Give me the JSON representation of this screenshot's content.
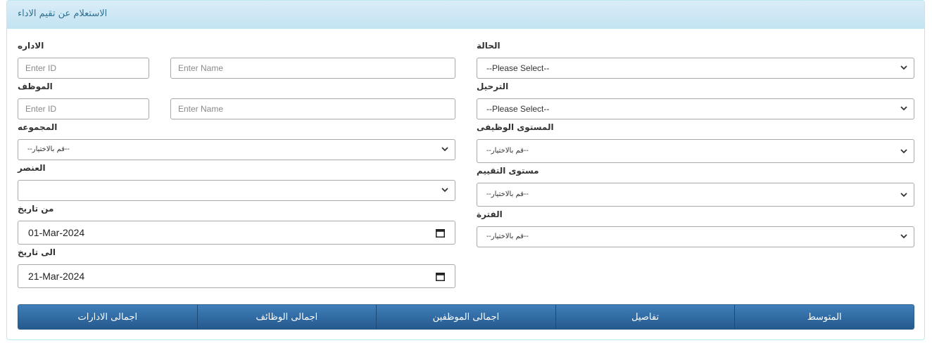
{
  "panel": {
    "title": "الاستعلام عن تقيم الاداء"
  },
  "labels": {
    "department": "الاداره",
    "employee": "الموظف",
    "group": "المجموعه",
    "element": "العنصر",
    "from_date": "من تاريخ",
    "to_date": "الى تاريخ",
    "status": "الحالة",
    "posting": "الترحيل",
    "job_level": "المستوى الوظيفى",
    "eval_level": "مستوى التقييم",
    "period": "الفترة"
  },
  "fields": {
    "department_id": {
      "placeholder": "Enter ID",
      "value": ""
    },
    "department_name": {
      "placeholder": "Enter Name",
      "value": ""
    },
    "employee_id": {
      "placeholder": "Enter ID",
      "value": ""
    },
    "employee_name": {
      "placeholder": "Enter Name",
      "value": ""
    },
    "group_select": "--قم بالاختيار--",
    "element_select": "",
    "from_date": "01-Mar-2024",
    "to_date": "21-Mar-2024",
    "status_select": "--Please Select--",
    "posting_select": "--Please Select--",
    "job_level_select": "--قم بالاختيار--",
    "eval_level_select": "--قم بالاختيار--",
    "period_select": "--قم بالاختيار--"
  },
  "buttons": [
    "اجمالى الادارات",
    "اجمالى الوظائف",
    "اجمالى الموظفين",
    "تفاصيل",
    "المتوسط"
  ],
  "icons": {
    "select_arrow": "chevron-down-icon",
    "date_picker": "calendar-icon"
  },
  "colors": {
    "header_bg": "#d9edf7",
    "header_text": "#31708f",
    "button_bg": "#337ab7"
  }
}
